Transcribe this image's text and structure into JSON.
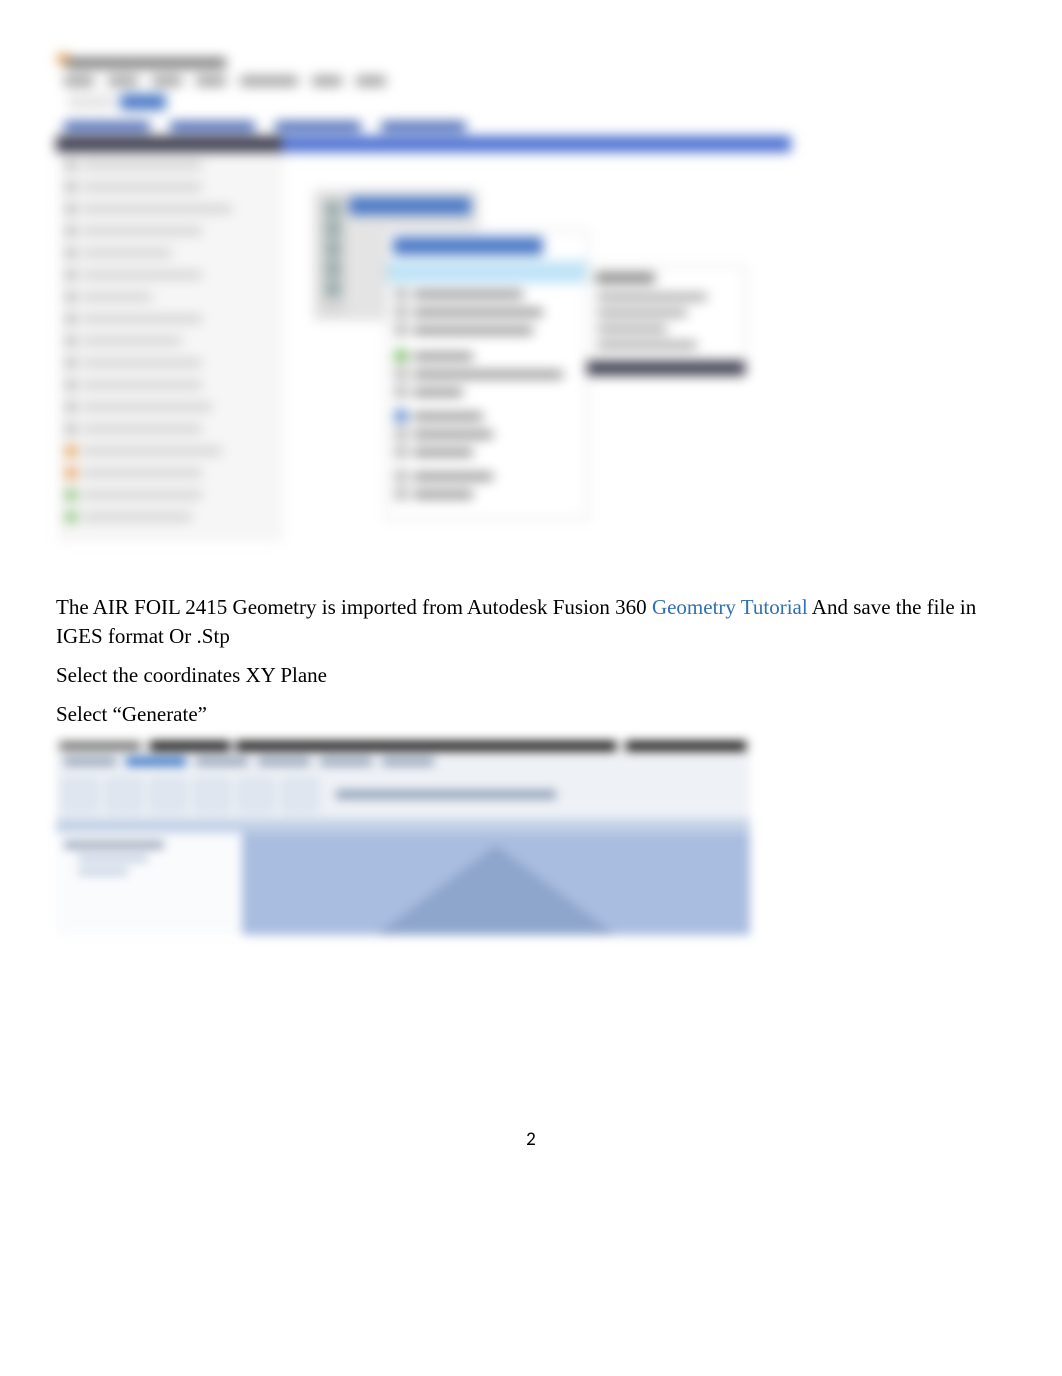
{
  "paragraphs": {
    "p1_a": "The AIR FOIL 2415  Geometry is imported from Autodesk Fusion 360 ",
    "p1_link": "Geometry Tutorial",
    "p1_b": " And save the file in IGES format Or .Stp",
    "p2": "Select the coordinates XY Plane",
    "p3": "Select “Generate”"
  },
  "page_number": "2"
}
